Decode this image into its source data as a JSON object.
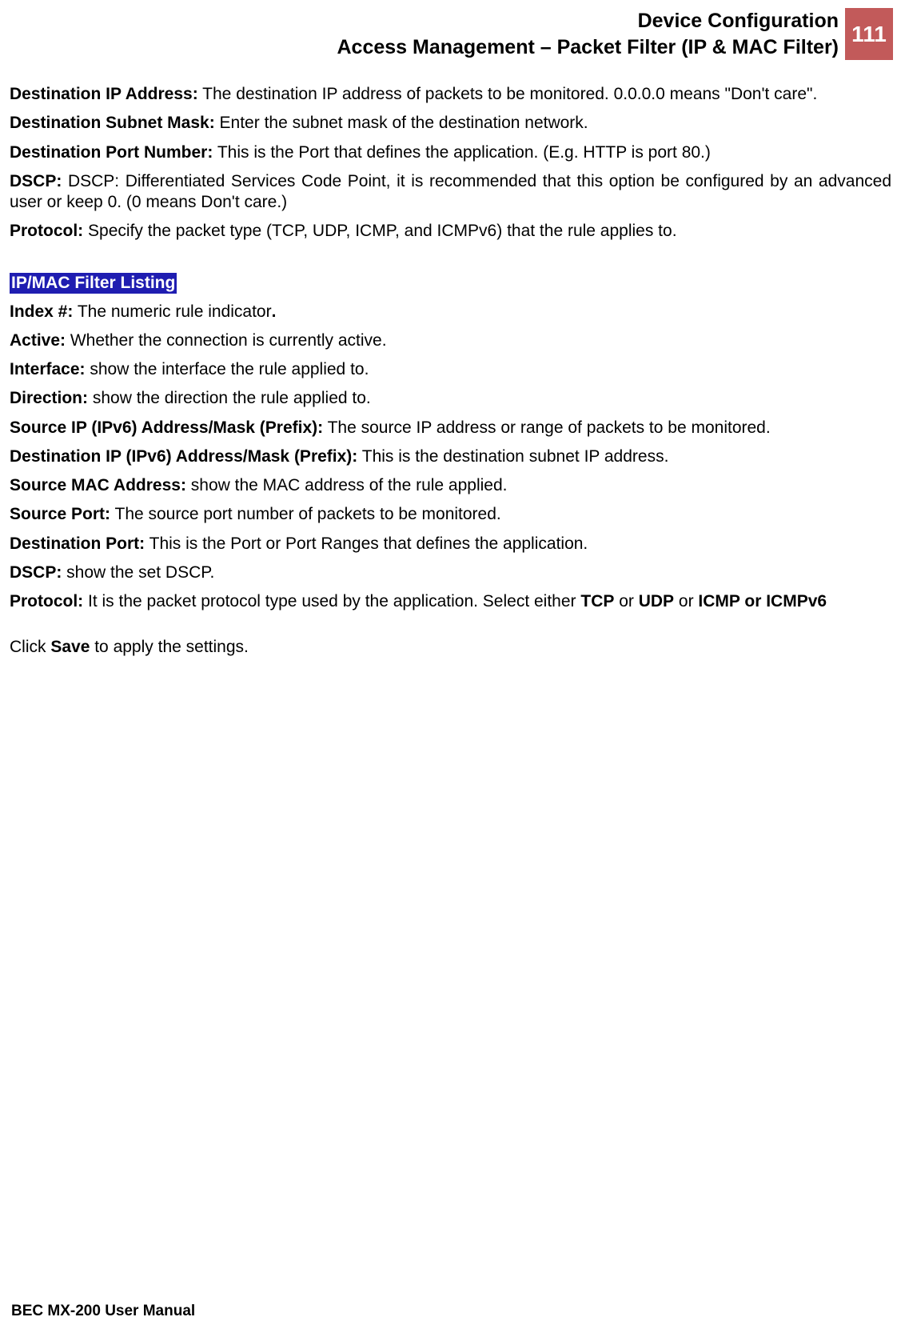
{
  "header": {
    "line1": "Device Configuration",
    "line2": "Access Management – Packet Filter (IP & MAC Filter)",
    "page_number": "111"
  },
  "defs_top": [
    {
      "term": "Destination IP Address:",
      "desc": " The destination IP address of packets to be monitored.  0.0.0.0 means \"Don't care\"."
    },
    {
      "term": "Destination Subnet Mask:",
      "desc": " Enter the subnet mask of the destination network."
    },
    {
      "term": "Destination Port Number:",
      "desc": " This is the Port that defines the application. (E.g. HTTP is port 80.)"
    },
    {
      "term": "DSCP:",
      "desc": " DSCP: Differentiated Services Code Point, it is recommended that this option be configured by an advanced user or keep 0. (0 means Don't care.)"
    },
    {
      "term": "Protocol:",
      "desc": " Specify the packet type (TCP, UDP, ICMP, and ICMPv6) that the rule applies to."
    }
  ],
  "section_heading": "IP/MAC Filter Listing",
  "defs_list": [
    {
      "term": "Index #:",
      "desc_before": " The numeric rule indicator",
      "bold_tail": ".",
      "desc_after": ""
    },
    {
      "term": "Active:",
      "desc_before": " Whether the connection is currently active.",
      "bold_tail": "",
      "desc_after": ""
    },
    {
      "term": "Interface:",
      "desc_before": " show the interface the rule applied to.",
      "bold_tail": "",
      "desc_after": ""
    },
    {
      "term": "Direction:",
      "desc_before": " show the direction the rule applied to.",
      "bold_tail": "",
      "desc_after": ""
    },
    {
      "term": "Source IP (IPv6) Address/Mask (Prefix):",
      "desc_before": " The source IP address or range of packets to be monitored.",
      "bold_tail": "",
      "desc_after": ""
    },
    {
      "term": "Destination IP (IPv6) Address/Mask (Prefix):",
      "desc_before": " This is the destination subnet IP address.",
      "bold_tail": "",
      "desc_after": ""
    },
    {
      "term": "Source MAC Address:",
      "desc_before": " show the MAC address of the rule applied.",
      "bold_tail": "",
      "desc_after": ""
    },
    {
      "term": "Source Port:",
      "desc_before": " The source port number of packets to be monitored.",
      "bold_tail": "",
      "desc_after": ""
    },
    {
      "term": "Destination Port:",
      "desc_before": " This is the Port or Port Ranges that defines the application.",
      "bold_tail": "",
      "desc_after": ""
    },
    {
      "term": "DSCP:",
      "desc_before": " show the set DSCP.",
      "bold_tail": "",
      "desc_after": ""
    }
  ],
  "protocol_def": {
    "term": "Protocol:",
    "before": " It is the packet protocol type used by the application. Select either ",
    "b1": "TCP",
    "mid1": " or ",
    "b2": "UDP",
    "mid2": " or ",
    "b3": "ICMP or ICMPv6"
  },
  "save_line": {
    "before": "Click ",
    "bold": "Save",
    "after": " to apply the settings."
  },
  "footer": "BEC MX-200 User Manual"
}
